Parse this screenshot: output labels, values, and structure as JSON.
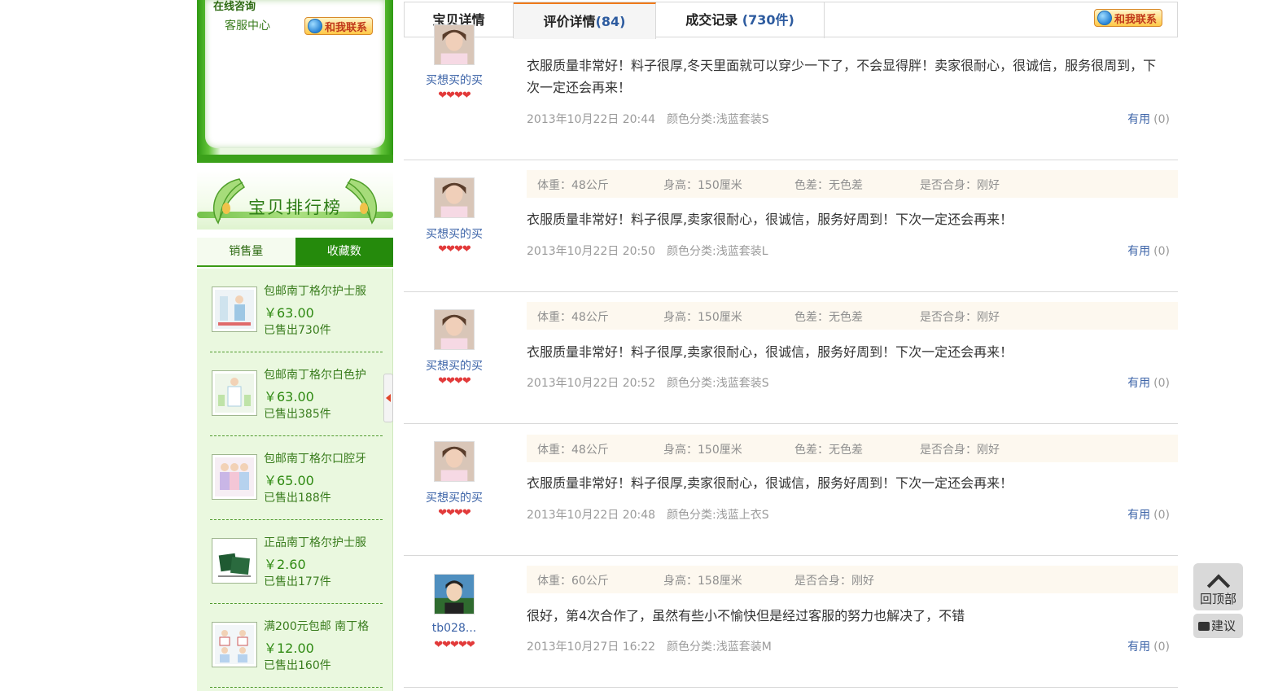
{
  "sidebar": {
    "consult": {
      "title": "在线咨询",
      "label": "客服中心",
      "contact_label": "和我联系"
    },
    "rank": {
      "title": "宝贝排行榜",
      "tabs": [
        "销售量",
        "收藏数"
      ],
      "active_tab": "收藏数",
      "items": [
        {
          "name": "包邮南丁格尔护士服",
          "price": "￥63.00",
          "sold": "已售出730件"
        },
        {
          "name": "包邮南丁格尔白色护",
          "price": "￥63.00",
          "sold": "已售出385件"
        },
        {
          "name": "包邮南丁格尔口腔牙",
          "price": "￥65.00",
          "sold": "已售出188件"
        },
        {
          "name": "正品南丁格尔护士服",
          "price": "￥2.60",
          "sold": "已售出177件"
        },
        {
          "name": "满200元包邮 南丁格",
          "price": "￥12.00",
          "sold": "已售出160件"
        }
      ]
    }
  },
  "tabs": {
    "details": "宝贝详情",
    "reviews": "评价详情",
    "reviews_count": "(84)",
    "transactions": "成交记录",
    "transactions_count": "(730件)",
    "active": "评价详情",
    "contact_label": "和我联系"
  },
  "reviews": [
    {
      "user": "买想买的买",
      "hearts": "❤❤❤❤",
      "attrs": [],
      "content": "衣服质量非常好！料子很厚,冬天里面就可以穿少一下了，不会显得胖！卖家很耐心，很诚信，服务很周到，下次一定还会再来！",
      "date": "2013年10月22日 20:44",
      "spec": "颜色分类:浅蓝套装S",
      "useful_label": "有用",
      "useful_count": "(0)"
    },
    {
      "user": "买想买的买",
      "hearts": "❤❤❤❤",
      "attrs": [
        "体重：48公斤",
        "身高：150厘米",
        "色差：无色差",
        "是否合身：刚好"
      ],
      "content": "衣服质量非常好！料子很厚,卖家很耐心，很诚信，服务好周到！下次一定还会再来！",
      "date": "2013年10月22日 20:50",
      "spec": "颜色分类:浅蓝套装L",
      "useful_label": "有用",
      "useful_count": "(0)"
    },
    {
      "user": "买想买的买",
      "hearts": "❤❤❤❤",
      "attrs": [
        "体重：48公斤",
        "身高：150厘米",
        "色差：无色差",
        "是否合身：刚好"
      ],
      "content": "衣服质量非常好！料子很厚,卖家很耐心，很诚信，服务好周到！下次一定还会再来！",
      "date": "2013年10月22日 20:52",
      "spec": "颜色分类:浅蓝套装S",
      "useful_label": "有用",
      "useful_count": "(0)"
    },
    {
      "user": "买想买的买",
      "hearts": "❤❤❤❤",
      "attrs": [
        "体重：48公斤",
        "身高：150厘米",
        "色差：无色差",
        "是否合身：刚好"
      ],
      "content": "衣服质量非常好！料子很厚,卖家很耐心，很诚信，服务好周到！下次一定还会再来！",
      "date": "2013年10月22日 20:48",
      "spec": "颜色分类:浅蓝上衣S",
      "useful_label": "有用",
      "useful_count": "(0)"
    },
    {
      "user": "tb028...",
      "hearts": "❤❤❤❤❤",
      "attrs": [
        "体重：60公斤",
        "身高：158厘米",
        "是否合身：刚好"
      ],
      "content": "很好，第4次合作了，虽然有些小不愉快但是经过客服的努力也解决了，不错",
      "date": "2013年10月27日 16:22",
      "spec": "颜色分类:浅蓝套装M",
      "useful_label": "有用",
      "useful_count": "(0)"
    }
  ],
  "float_tools": {
    "back_to_top": "回顶部",
    "feedback": "建议"
  },
  "colors": {
    "brand_green": "#258a0c",
    "link_blue": "#3d64a8",
    "tab_accent": "#f07a1a",
    "heart_red": "#e23a3a"
  }
}
